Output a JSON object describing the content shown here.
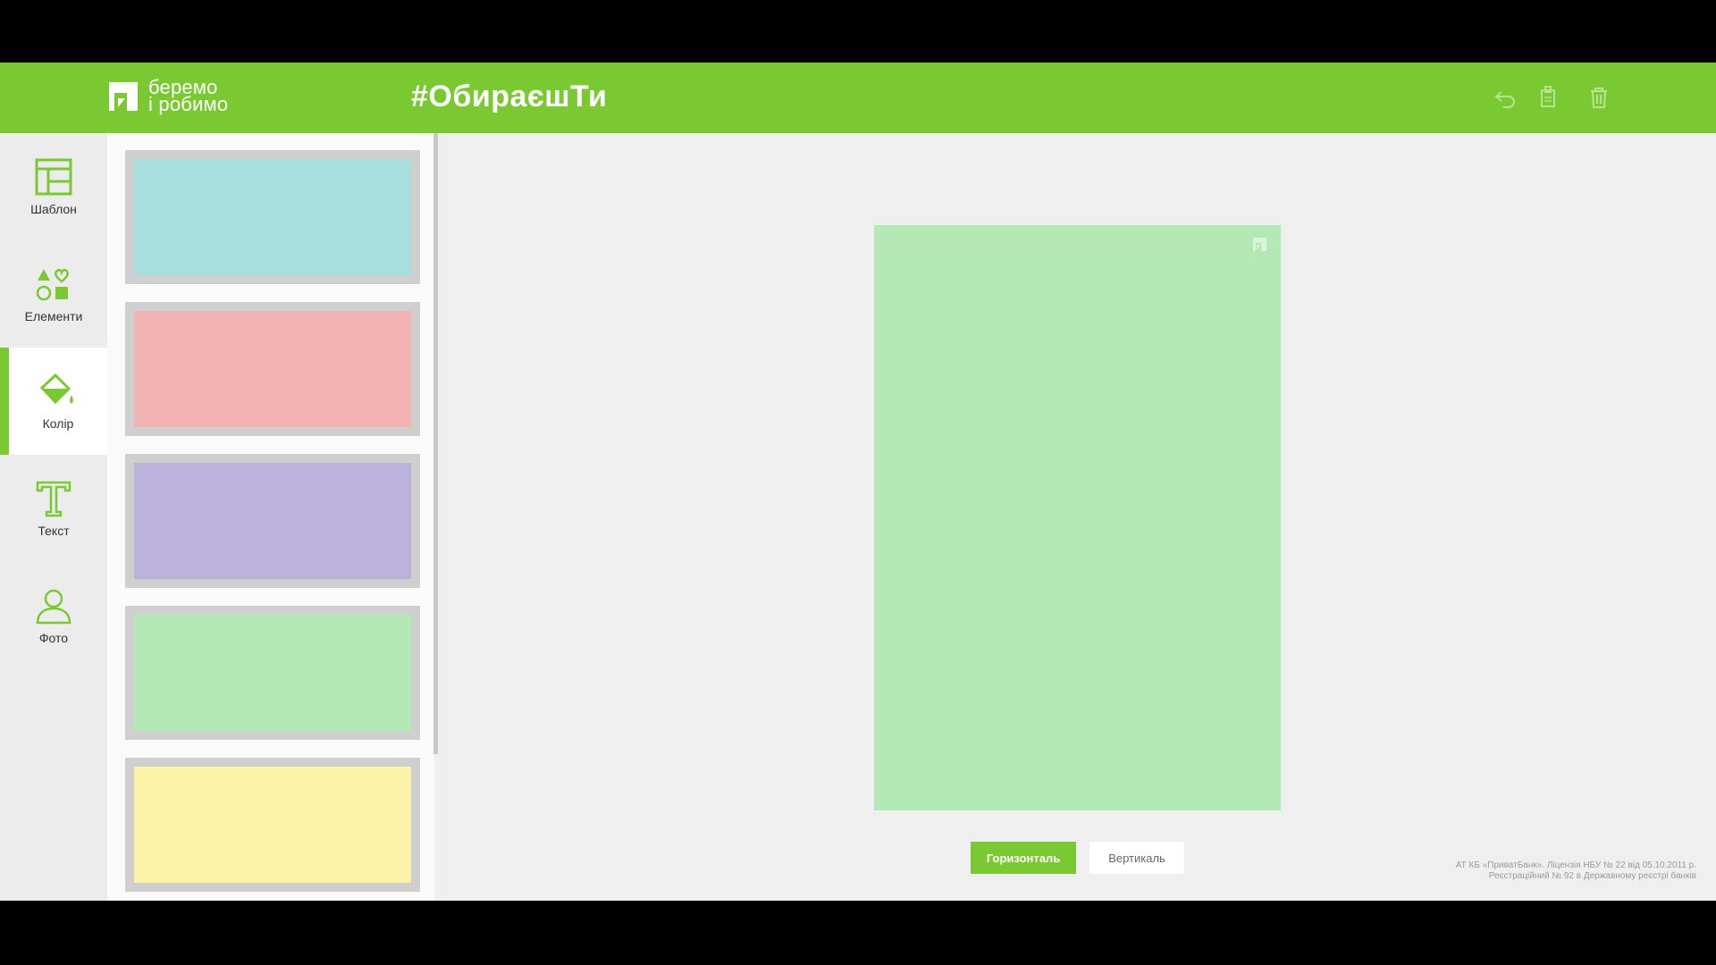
{
  "header": {
    "logo_line1": "беремо",
    "logo_line2": "і робимо",
    "hashtag": "#ОбираєшТи",
    "brand_color": "#7ac932",
    "icons": [
      "undo-icon",
      "copy-icon",
      "trash-icon"
    ]
  },
  "sidebar": {
    "items": [
      {
        "label": "Шаблон",
        "icon": "template-icon"
      },
      {
        "label": "Елементи",
        "icon": "shapes-icon"
      },
      {
        "label": "Колір",
        "icon": "paint-bucket-icon",
        "active": true
      },
      {
        "label": "Текст",
        "icon": "text-icon"
      },
      {
        "label": "Фото",
        "icon": "person-icon"
      }
    ]
  },
  "colors": {
    "swatches": [
      "#a6dfdd",
      "#f2b3b3",
      "#bbb2d9",
      "#b2e9b4",
      "#fbf1a7"
    ],
    "selected": "#b2e9b4"
  },
  "orientation": {
    "horizontal_label": "Горизонталь",
    "vertical_label": "Вертикаль",
    "selected": "horizontal"
  },
  "footer": {
    "line1": "АТ КБ «ПриватБанк». Ліцензія НБУ № 22 від 05.10.2011 р.",
    "line2": "Реєстраційний № 92 в Державному реєстрі банків"
  }
}
